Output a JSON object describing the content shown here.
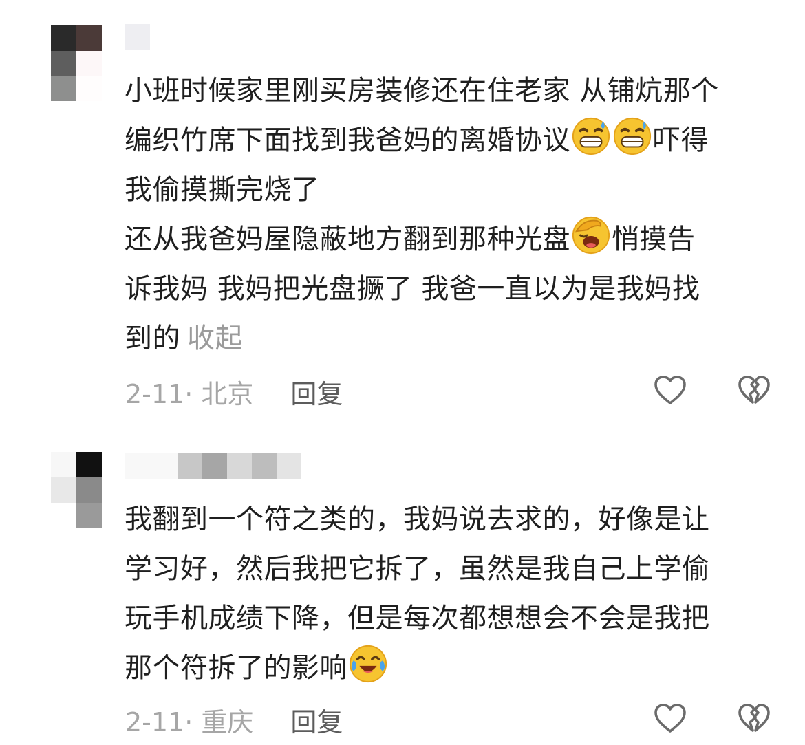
{
  "colors": {
    "text": "#1f1f1f",
    "meta": "#a6a6a6",
    "reply": "#5c5c5c",
    "icon": "#6b6b6b"
  },
  "comments": [
    {
      "avatar_tiles": [
        "#2a2a2a",
        "#4b3a38",
        "#5e5e5e",
        "#fdf7f8",
        "#8e8f8e",
        "#fffdfd"
      ],
      "username_tiles": [
        "#eeeef2"
      ],
      "lines": [
        "小班时候家里刚买房装修还在住老家 从铺炕那个",
        "编织竹席下面找到我爸妈的离婚协议",
        "吓得",
        "我偷摸撕完烧了",
        "还从我爸妈屋隐蔽地方翻到那种光盘",
        "悄摸告",
        "诉我妈 我妈把光盘撅了 我爸一直以为是我妈找",
        "到的"
      ],
      "emojis": [
        "grinning-sweat-emoji",
        "grinning-sweat-emoji",
        "face-palm-emoji"
      ],
      "collapse_label": "收起",
      "date_location": "2-11· 北京",
      "reply_label": "回复",
      "like_icon": "heart-icon",
      "dislike_icon": "broken-heart-icon"
    },
    {
      "avatar_tiles": [
        "#f7f7f7",
        "#111111",
        "#e8e8e8",
        "#8a8a8a",
        "#ffffff",
        "#9a9a9a"
      ],
      "username_tiles": [
        "#f8f8f8",
        "#c7c7c7",
        "#a6a6a6",
        "#d8d8d8",
        "#bdbdbd",
        "#e4e4e4"
      ],
      "lines": [
        "我翻到一个符之类的，我妈说去求的，好像是让",
        "学习好，然后我把它拆了，虽然是我自己上学偷",
        "玩手机成绩下降，但是每次都想想会不会是我把",
        "那个符拆了的影响"
      ],
      "emojis": [
        "crying-laughing-emoji"
      ],
      "date_location": "2-11· 重庆",
      "reply_label": "回复",
      "like_icon": "heart-icon",
      "dislike_icon": "broken-heart-icon"
    }
  ]
}
